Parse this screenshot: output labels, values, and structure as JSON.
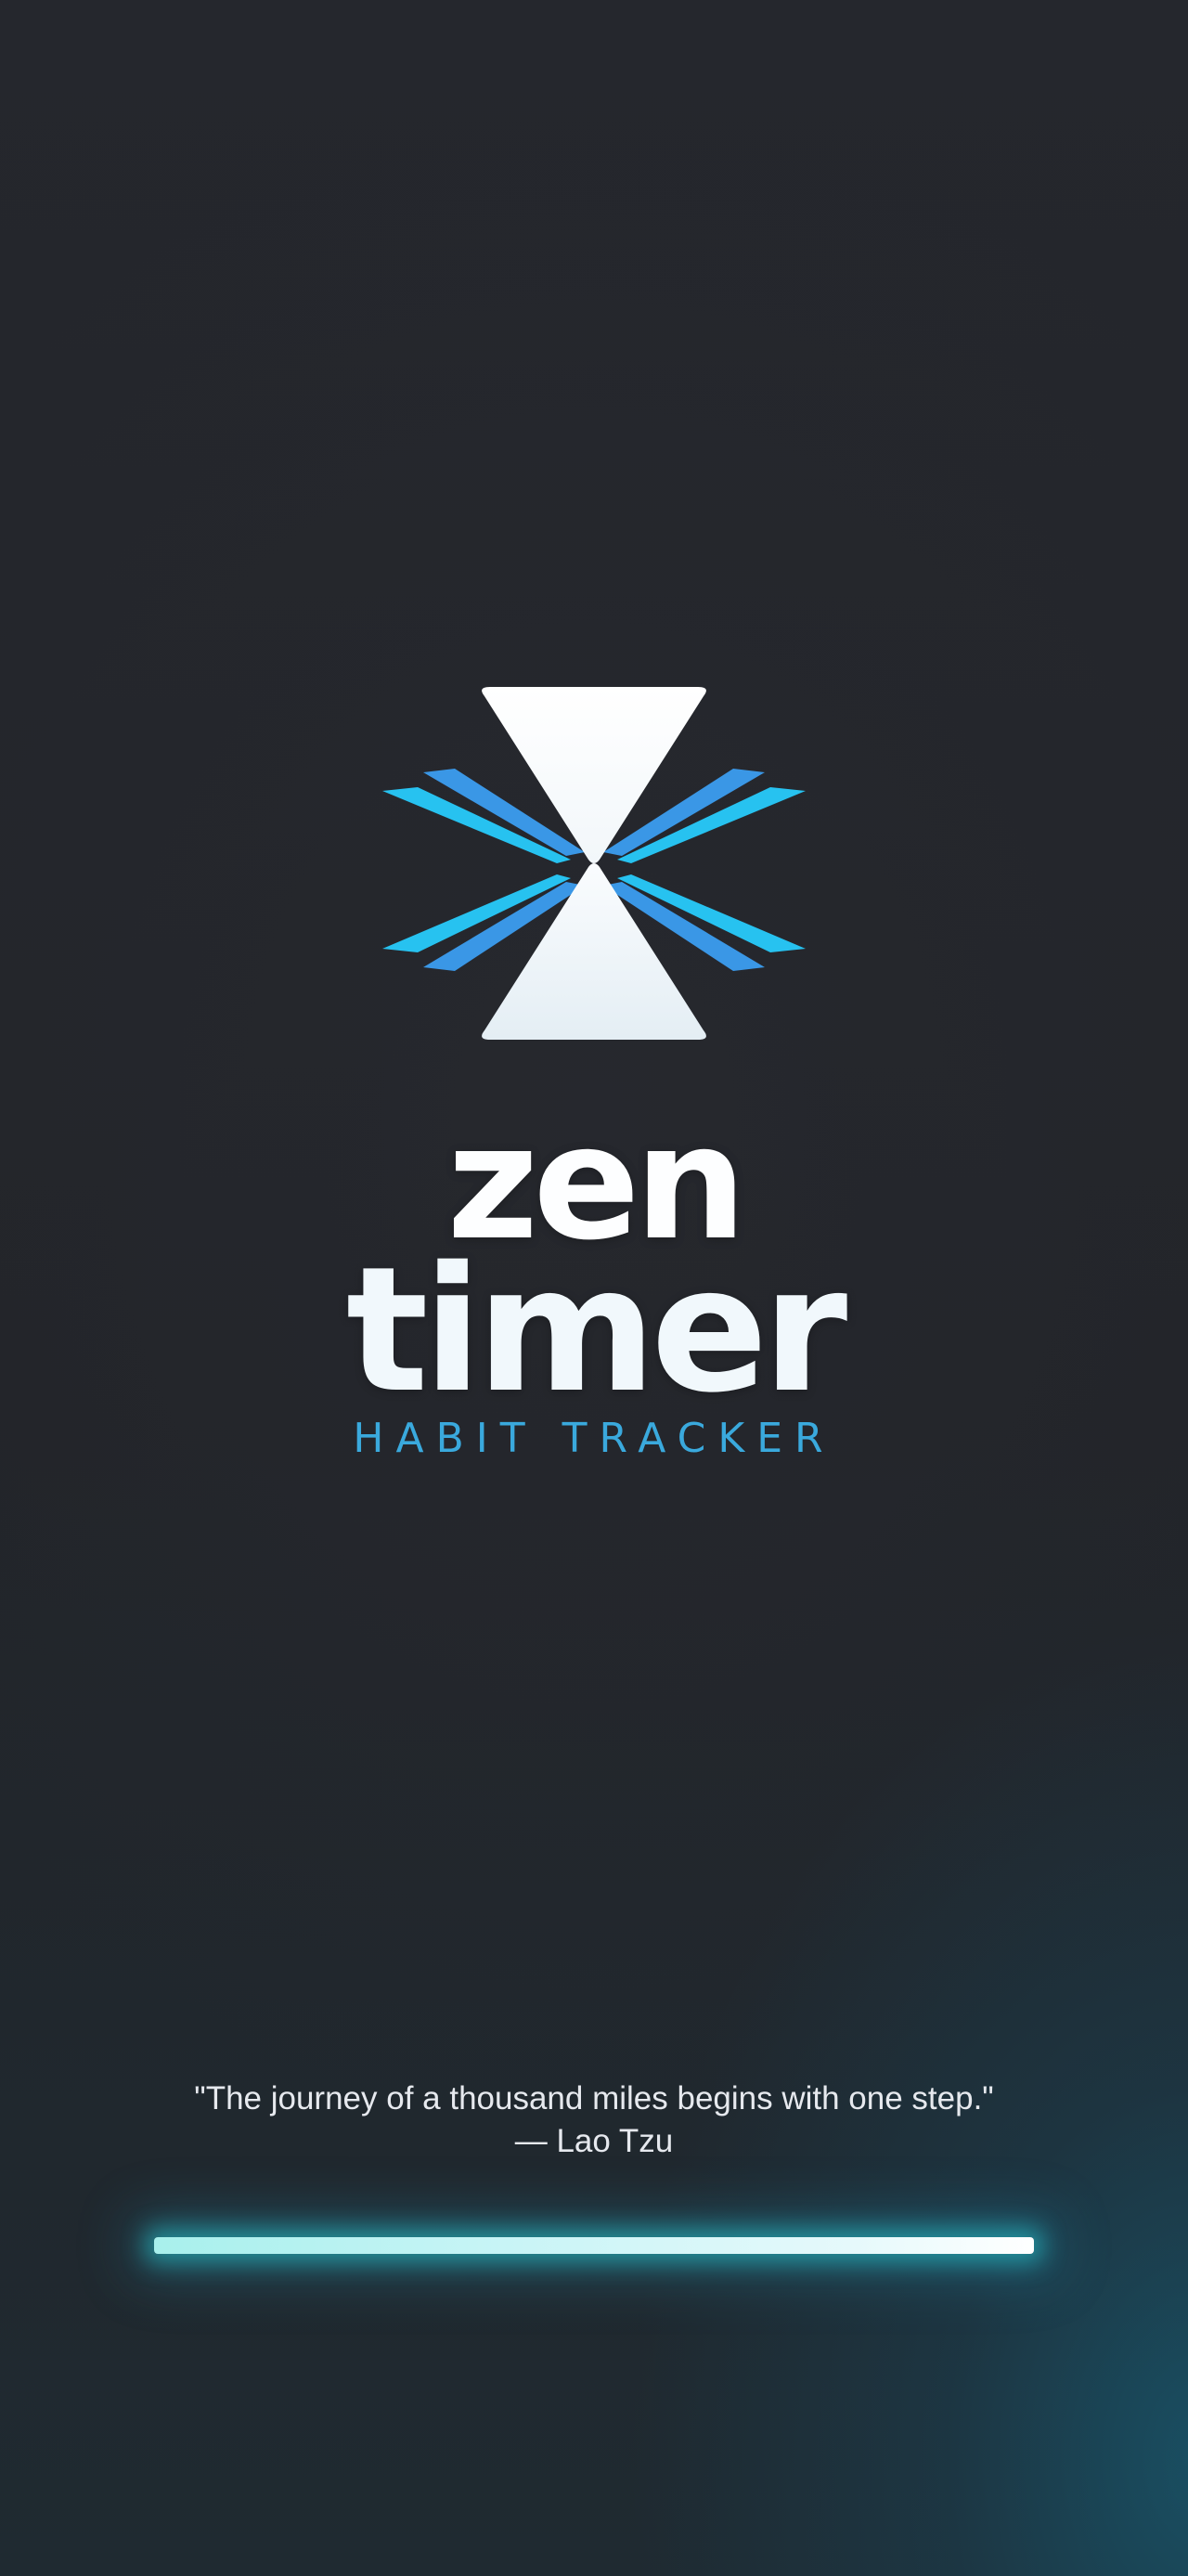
{
  "app": {
    "name_line1": "zen",
    "name_line2": "timer",
    "tagline": "HABIT TRACKER"
  },
  "logo": {
    "icon": "hourglass-icon",
    "colors": {
      "hourglass": "#ffffff",
      "wings_light": "#27c2f0",
      "wings_dark": "#3a97e6"
    }
  },
  "quote": {
    "text": "\"The journey of a thousand miles begins with one step.\"",
    "author": "— Lao Tzu"
  },
  "loading": {
    "progress": 1.0,
    "color_start": "#2fd3d0",
    "color_end": "#ffffff"
  },
  "theme": {
    "background": "#23252b",
    "accent": "#3aa9dd"
  }
}
